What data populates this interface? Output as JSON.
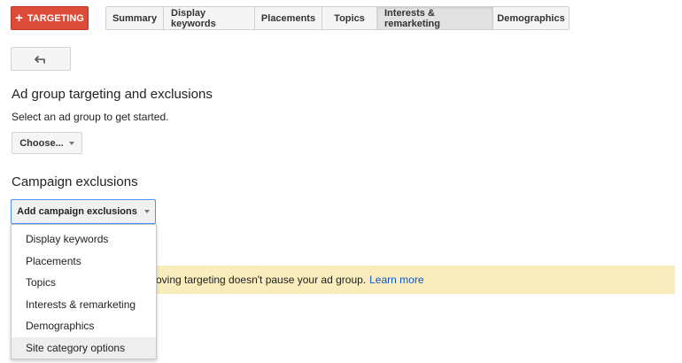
{
  "toolbar": {
    "targeting_button": {
      "plus": "+",
      "label": "TARGETING"
    },
    "tabs": [
      {
        "label": "Summary"
      },
      {
        "label": "Display keywords"
      },
      {
        "label": "Placements"
      },
      {
        "label": "Topics"
      },
      {
        "label": "Interests & remarketing",
        "active": true
      },
      {
        "label": "Demographics"
      }
    ],
    "back_icon": "back-arrow-icon"
  },
  "ad_group_section": {
    "title": "Ad group targeting and exclusions",
    "subtitle": "Select an ad group to get started.",
    "choose_button": "Choose..."
  },
  "campaign_section": {
    "title": "Campaign exclusions",
    "add_button": "Add campaign exclusions"
  },
  "dropdown": {
    "items": [
      {
        "label": "Display keywords"
      },
      {
        "label": "Placements"
      },
      {
        "label": "Topics"
      },
      {
        "label": "Interests & remarketing"
      },
      {
        "label": "Demographics"
      },
      {
        "label": "Site category options",
        "hovered": true
      }
    ]
  },
  "notice": {
    "text": "oving targeting doesn't pause your ad group.",
    "link": "Learn more"
  },
  "colors": {
    "accent_red": "#dd4b39",
    "link_blue": "#1155cc",
    "notice_bg": "#f9edbe",
    "focus_blue": "#4d90fe"
  }
}
